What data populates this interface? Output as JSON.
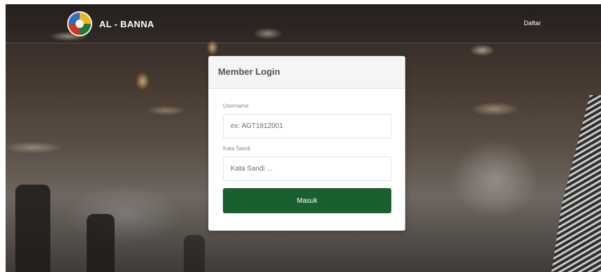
{
  "navbar": {
    "brand_name": "AL - BANNA",
    "register_link": "Daftar",
    "logo_icon": "al-banna-logo"
  },
  "login_panel": {
    "title": "Member Login",
    "username": {
      "label": "Username",
      "value": "",
      "placeholder": "ex: AGT1812001"
    },
    "password": {
      "label": "Kata Sandi",
      "value": "",
      "placeholder": "Kata Sandi ..."
    },
    "submit_label": "Masuk"
  },
  "colors": {
    "primary_button": "#18602f",
    "panel_background": "#ffffff",
    "panel_heading_background": "#f5f5f5"
  }
}
